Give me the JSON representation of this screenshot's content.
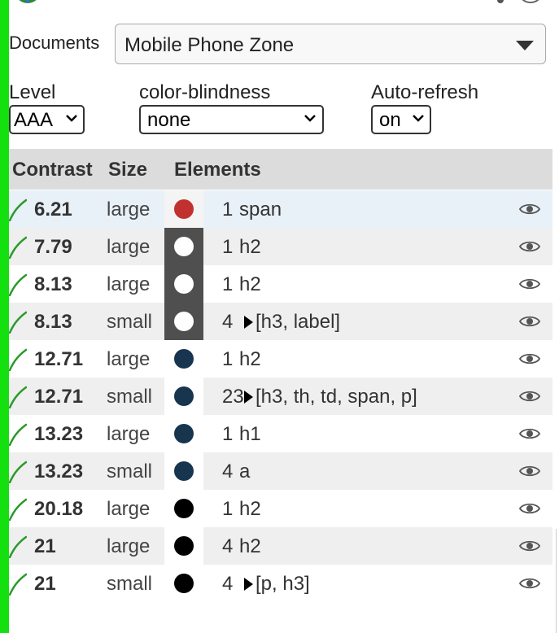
{
  "documents": {
    "label": "Documents",
    "selected": "Mobile Phone Zone"
  },
  "filters": {
    "level": {
      "label": "Level",
      "value": "AAA"
    },
    "color_blindness": {
      "label": "color-blindness",
      "value": "none"
    },
    "auto_refresh": {
      "label": "Auto-refresh",
      "value": "on"
    }
  },
  "table": {
    "headers": {
      "contrast": "Contrast",
      "size": "Size",
      "elements": "Elements"
    },
    "rows": [
      {
        "contrast": "6.21",
        "size": "large",
        "swatch_bg": "#f4f4f4",
        "dot_color": "#c0312f",
        "count": "1",
        "expandable": false,
        "elements": "span",
        "row_bg": "#e8f0f8"
      },
      {
        "contrast": "7.79",
        "size": "large",
        "swatch_bg": "#4f4f4f",
        "dot_color": "#ffffff",
        "count": "1",
        "expandable": false,
        "elements": "h2",
        "row_bg": "#efefef"
      },
      {
        "contrast": "8.13",
        "size": "large",
        "swatch_bg": "#4f4f4f",
        "dot_color": "#ffffff",
        "count": "1",
        "expandable": false,
        "elements": "h2",
        "row_bg": "#ffffff"
      },
      {
        "contrast": "8.13",
        "size": "small",
        "swatch_bg": "#4f4f4f",
        "dot_color": "#ffffff",
        "count": "4",
        "expandable": true,
        "elements": "[h3, label]",
        "row_bg": "#efefef"
      },
      {
        "contrast": "12.71",
        "size": "large",
        "swatch_bg": "#ffffff",
        "dot_color": "#17354f",
        "count": "1",
        "expandable": false,
        "elements": "h2",
        "row_bg": "#ffffff"
      },
      {
        "contrast": "12.71",
        "size": "small",
        "swatch_bg": "#ffffff",
        "dot_color": "#17354f",
        "count": "23",
        "expandable": true,
        "elements": "[h3, th, td, span, p]",
        "row_bg": "#efefef"
      },
      {
        "contrast": "13.23",
        "size": "large",
        "swatch_bg": "#ffffff",
        "dot_color": "#17354f",
        "count": "1",
        "expandable": false,
        "elements": "h1",
        "row_bg": "#ffffff"
      },
      {
        "contrast": "13.23",
        "size": "small",
        "swatch_bg": "#ffffff",
        "dot_color": "#17354f",
        "count": "4",
        "expandable": false,
        "elements": "a",
        "row_bg": "#efefef"
      },
      {
        "contrast": "20.18",
        "size": "large",
        "swatch_bg": "#ffffff",
        "dot_color": "#000000",
        "count": "1",
        "expandable": false,
        "elements": "h2",
        "row_bg": "#ffffff"
      },
      {
        "contrast": "21",
        "size": "large",
        "swatch_bg": "#ffffff",
        "dot_color": "#000000",
        "count": "4",
        "expandable": false,
        "elements": "h2",
        "row_bg": "#efefef"
      },
      {
        "contrast": "21",
        "size": "small",
        "swatch_bg": "#ffffff",
        "dot_color": "#000000",
        "count": "4",
        "expandable": true,
        "elements": "[p, h3]",
        "row_bg": "#ffffff"
      }
    ]
  },
  "icons": {
    "pass": "check-icon",
    "visibility": "eye-icon",
    "expand": "triangle-right-icon"
  },
  "colors": {
    "accent_green": "#15e00f",
    "check_green": "#2a9a2a",
    "header_bg": "#dcdcdc"
  }
}
